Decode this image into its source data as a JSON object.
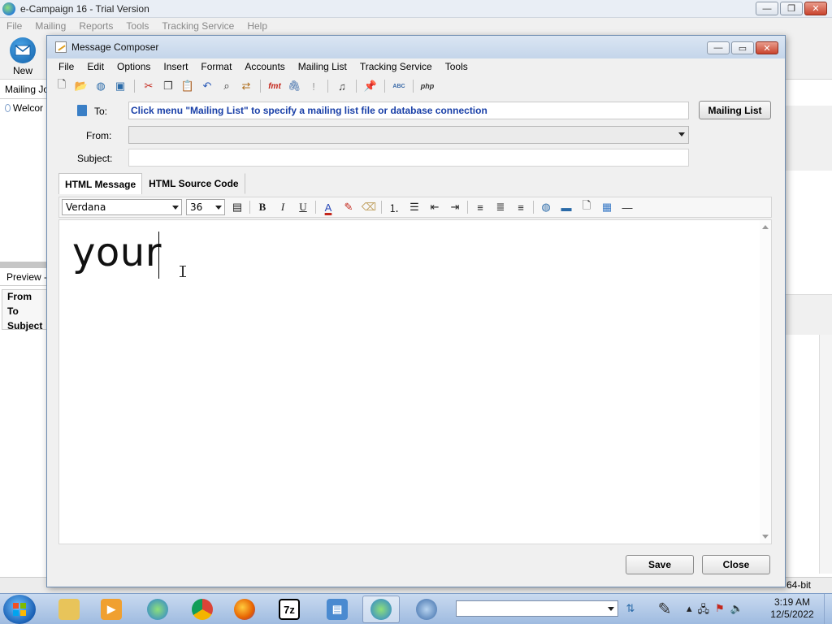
{
  "main_window": {
    "title": "e-Campaign 16 - Trial Version",
    "menu": [
      "File",
      "Mailing",
      "Reports",
      "Tools",
      "Tracking Service",
      "Help"
    ],
    "new_button_label": "New",
    "left_panel_header": "Mailing Jo",
    "left_panel_item": "Welcor",
    "preview_header": "Preview -",
    "preview_fields": [
      "From",
      "To",
      "Subject"
    ],
    "status_text": "64-bit"
  },
  "composer": {
    "title": "Message Composer",
    "menu": [
      "File",
      "Edit",
      "Options",
      "Insert",
      "Format",
      "Accounts",
      "Mailing List",
      "Tracking Service",
      "Tools"
    ],
    "toolbar_icons": [
      "new-document-icon",
      "open-folder-icon",
      "web-globe-icon",
      "save-disk-icon",
      "cut-icon",
      "copy-icon",
      "paste-icon",
      "undo-icon",
      "find-binoculars-icon",
      "replace-icon",
      "fmt-icon",
      "attachment-icon",
      "priority-icon",
      "music-icon",
      "pin-icon",
      "spellcheck-icon",
      "php-icon"
    ],
    "toolbar_text": {
      "fmt": "fmt",
      "php": "php",
      "abc": "ABC"
    },
    "to_label": "To:",
    "to_value": "Click menu \"Mailing List\" to specify a mailing list file or database connection",
    "mailing_list_button": "Mailing List",
    "from_label": "From:",
    "from_value": "",
    "subject_label": "Subject:",
    "subject_value": "",
    "tabs": [
      "HTML Message",
      "HTML Source Code"
    ],
    "active_tab": "HTML Message",
    "font_name": "Verdana",
    "font_size": "36",
    "format_buttons": [
      "B",
      "I",
      "U"
    ],
    "editor_text": "your",
    "save_button": "Save",
    "close_button": "Close"
  },
  "taskbar": {
    "apps": [
      "file-explorer",
      "media-player",
      "e-campaign",
      "chrome",
      "firefox",
      "7zip",
      "remote-desktop",
      "e-campaign-2",
      "network-globe"
    ],
    "app_7zip_label": "7z",
    "time": "3:19 AM",
    "date": "12/5/2022"
  },
  "colors": {
    "to_text": "#1a40a8",
    "titlebar": "#c4d5ea",
    "taskbar": "#9fbbe0"
  }
}
